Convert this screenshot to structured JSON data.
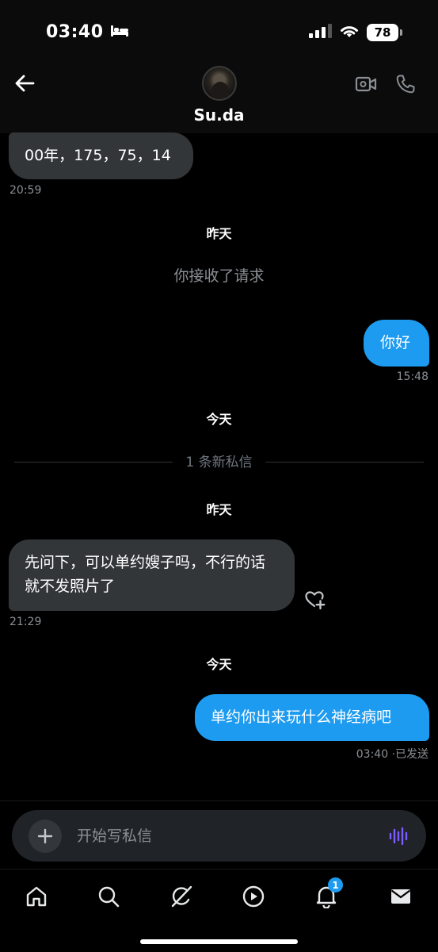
{
  "status_bar": {
    "time": "03:40",
    "battery": "78"
  },
  "header": {
    "contact_name": "Su.da"
  },
  "messages": [
    {
      "type": "received",
      "text": "00年，175，75，14",
      "time": "20:59"
    },
    {
      "type": "date",
      "text": "昨天"
    },
    {
      "type": "system",
      "text": "你接收了请求"
    },
    {
      "type": "sent",
      "text": "你好",
      "time": "15:48"
    },
    {
      "type": "date",
      "text": "今天"
    },
    {
      "type": "divider",
      "text": "1 条新私信"
    },
    {
      "type": "date",
      "text": "昨天"
    },
    {
      "type": "received",
      "text": "先问下，可以单约嫂子吗，不行的话就不发照片了",
      "time": "21:29"
    },
    {
      "type": "date",
      "text": "今天"
    },
    {
      "type": "sent",
      "text": "单约你出来玩什么神经病吧",
      "time": "03:40 ·已发送"
    }
  ],
  "composer": {
    "placeholder": "开始写私信"
  },
  "nav": {
    "items": [
      "home-icon",
      "search-icon",
      "grok-icon",
      "video-icon",
      "notifications-icon",
      "messages-icon"
    ],
    "notification_badge": "1"
  },
  "colors": {
    "accent": "#1d9bf0",
    "received_bubble": "#333639",
    "voice_icon": "#7c5cff",
    "background": "#000000"
  }
}
